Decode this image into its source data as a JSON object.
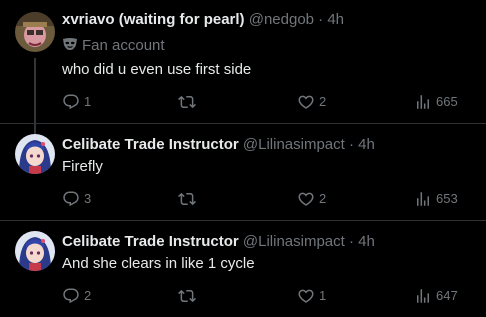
{
  "tweets": [
    {
      "display_name": "xvriavo (waiting for pearl)",
      "handle": "@nedgob",
      "separator": "·",
      "time": "4h",
      "badge_label": "Fan account",
      "text": "who did u even use first side",
      "reply_count": "1",
      "retweet_count": "",
      "like_count": "2",
      "view_count": "665"
    },
    {
      "display_name": "Celibate Trade Instructor",
      "handle": "@Lilinasimpact",
      "separator": "·",
      "time": "4h",
      "text": "Firefly",
      "reply_count": "3",
      "retweet_count": "",
      "like_count": "2",
      "view_count": "653"
    },
    {
      "display_name": "Celibate Trade Instructor",
      "handle": "@Lilinasimpact",
      "separator": "·",
      "time": "4h",
      "text": "And she clears in like 1 cycle",
      "reply_count": "2",
      "retweet_count": "",
      "like_count": "1",
      "view_count": "647"
    }
  ],
  "colors": {
    "background": "#000000",
    "primary_text": "#e7e9ea",
    "secondary_text": "#71767b",
    "divider": "#2f3336"
  },
  "icons": [
    "reply-icon",
    "retweet-icon",
    "like-icon",
    "views-icon",
    "fan-account-mask-icon"
  ]
}
